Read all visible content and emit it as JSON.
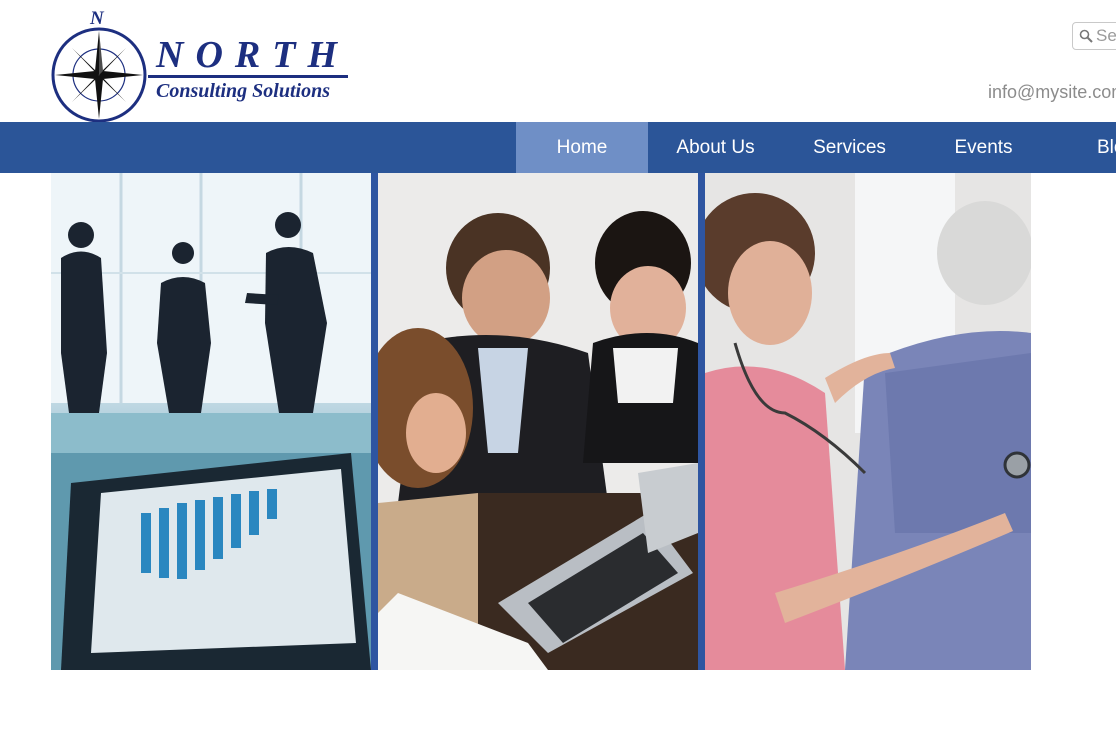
{
  "header": {
    "logo_letter": "N",
    "brand_name": "NORTH",
    "tagline": "Consulting Solutions",
    "search_placeholder": "Search...",
    "email": "info@mysite.com"
  },
  "nav": {
    "items": [
      {
        "label": "Home",
        "active": true
      },
      {
        "label": "About Us"
      },
      {
        "label": "Services"
      },
      {
        "label": "Events"
      },
      {
        "label": "Blog"
      }
    ]
  },
  "gallery": {
    "images": [
      {
        "subject": "business-meeting-silhouettes"
      },
      {
        "subject": "team-at-laptop"
      },
      {
        "subject": "nurse-with-stethoscope"
      }
    ]
  },
  "colors": {
    "brand_navy": "#1d2f80",
    "nav_bar": "#2b5598",
    "nav_active": "#6f8fc6",
    "gallery_border": "#2e55a1"
  }
}
